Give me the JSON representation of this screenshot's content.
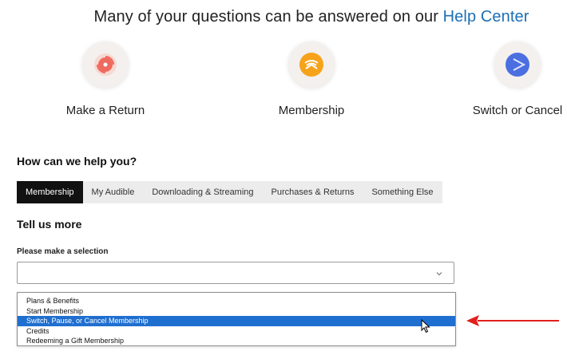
{
  "header": {
    "text": "Many of your questions can be answered on our",
    "link": "Help Center"
  },
  "quick_links": [
    {
      "label": "Make a Return",
      "icon": "return-icon"
    },
    {
      "label": "Membership",
      "icon": "audible-icon"
    },
    {
      "label": "Switch or Cancel",
      "icon": "play-icon"
    }
  ],
  "help": {
    "title": "How can we help you?",
    "tabs": [
      "Membership",
      "My Audible",
      "Downloading & Streaming",
      "Purchases & Returns",
      "Something Else"
    ],
    "active_tab": "Membership"
  },
  "form": {
    "title": "Tell us more",
    "field_label": "Please make a selection",
    "options": [
      "Plans & Benefits",
      "Start Membership",
      "Switch, Pause, or Cancel Membership",
      "Credits",
      "Redeeming a Gift Membership"
    ],
    "highlighted_option": "Switch, Pause, or Cancel Membership"
  },
  "colors": {
    "link": "#1c6fb5",
    "active_tab_bg": "#111111",
    "highlight": "#1f6fd0",
    "annotation_arrow": "#e0201c"
  }
}
